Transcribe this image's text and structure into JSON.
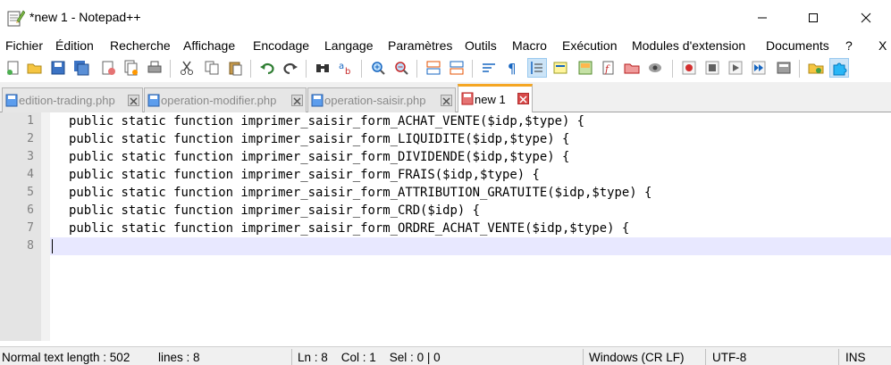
{
  "window": {
    "title": "*new 1 - Notepad++"
  },
  "menu": [
    {
      "label": "Fichier"
    },
    {
      "label": "Édition"
    },
    {
      "label": "Recherche"
    },
    {
      "label": "Affichage"
    },
    {
      "label": "Encodage"
    },
    {
      "label": "Langage"
    },
    {
      "label": "Paramètres"
    },
    {
      "label": "Outils"
    },
    {
      "label": "Macro"
    },
    {
      "label": "Exécution"
    },
    {
      "label": "Modules d'extension"
    },
    {
      "label": "Documents"
    },
    {
      "label": "?"
    },
    {
      "label": "X"
    }
  ],
  "tabs": [
    {
      "label": "edition-trading.php",
      "active": false
    },
    {
      "label": "operation-modifier.php",
      "active": false
    },
    {
      "label": "operation-saisir.php",
      "active": false
    },
    {
      "label": "new 1",
      "active": true
    }
  ],
  "editor": {
    "line_numbers": [
      "1",
      "2",
      "3",
      "4",
      "5",
      "6",
      "7",
      "8"
    ],
    "lines": [
      "public static function imprimer_saisir_form_ACHAT_VENTE($idp,$type) {",
      "public static function imprimer_saisir_form_LIQUIDITE($idp,$type) {",
      "public static function imprimer_saisir_form_DIVIDENDE($idp,$type) {",
      "public static function imprimer_saisir_form_FRAIS($idp,$type) {",
      "public static function imprimer_saisir_form_ATTRIBUTION_GRATUITE($idp,$type) {",
      "public static function imprimer_saisir_form_CRD($idp) {",
      "public static function imprimer_saisir_form_ORDRE_ACHAT_VENTE($idp,$type) {",
      ""
    ],
    "current_line_color": "#e8e8ff"
  },
  "status": {
    "length": "Normal text length : 502",
    "lines": "lines : 8",
    "position": "Ln : 8    Col : 1    Sel : 0 | 0",
    "eol": "Windows (CR LF)",
    "encoding": "UTF-8",
    "mode": "INS"
  },
  "colors": {
    "active_tab_accent": "#f5a623",
    "gutter": "#e4e4e4"
  }
}
